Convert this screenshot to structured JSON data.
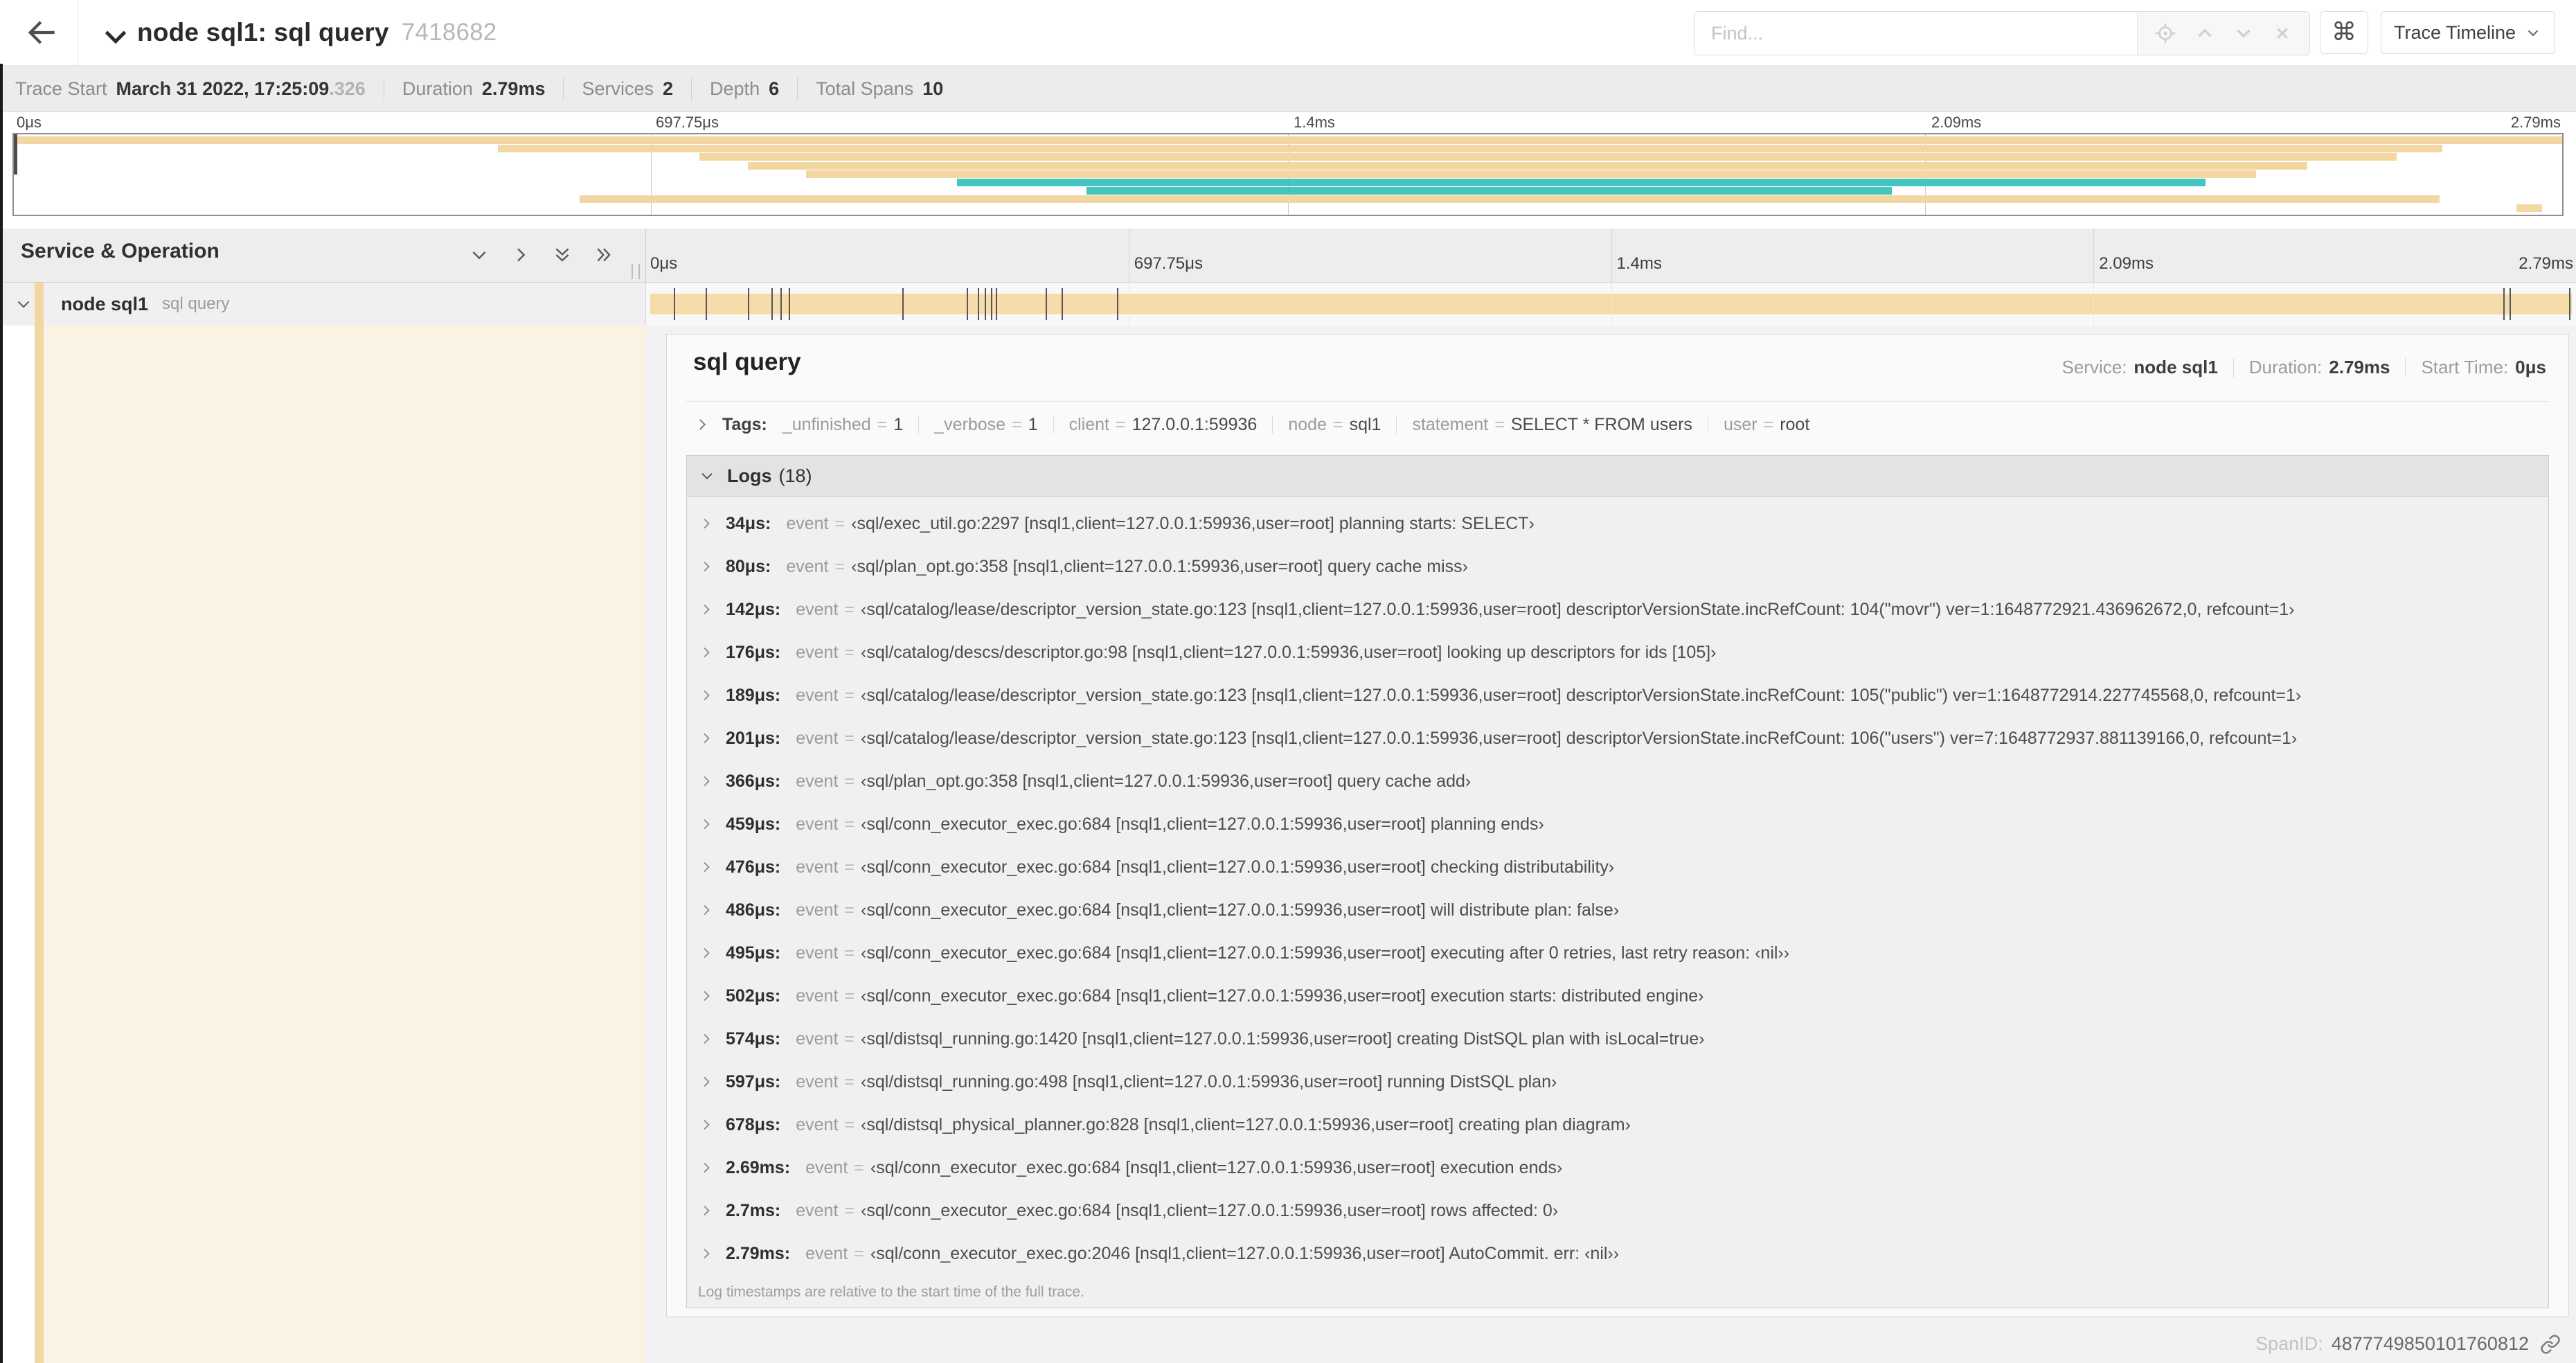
{
  "header": {
    "title": "node sql1: sql query",
    "trace_id": "7418682",
    "find_placeholder": "Find...",
    "shortcut_button": "⌘",
    "view_selector": "Trace Timeline"
  },
  "summary": {
    "items": [
      {
        "label": "Trace Start",
        "value": "March 31 2022, 17:25:09",
        "suffix": ".326"
      },
      {
        "label": "Duration",
        "value": "2.79ms"
      },
      {
        "label": "Services",
        "value": "2"
      },
      {
        "label": "Depth",
        "value": "6"
      },
      {
        "label": "Total Spans",
        "value": "10"
      }
    ]
  },
  "minimap": {
    "ticks": [
      "0μs",
      "697.75μs",
      "1.4ms",
      "2.09ms",
      "2.79ms"
    ],
    "duration_us": 2790,
    "spans": [
      {
        "start": 0.0,
        "end": 1.0,
        "color": "tan"
      },
      {
        "start": 0.19,
        "end": 0.953,
        "color": "tan"
      },
      {
        "start": 0.269,
        "end": 0.935,
        "color": "tan"
      },
      {
        "start": 0.288,
        "end": 0.9,
        "color": "tan"
      },
      {
        "start": 0.311,
        "end": 0.88,
        "color": "tan"
      },
      {
        "start": 0.37,
        "end": 0.86,
        "color": "teal"
      },
      {
        "start": 0.421,
        "end": 0.737,
        "color": "teal"
      },
      {
        "start": 0.222,
        "end": 0.952,
        "color": "tan"
      },
      {
        "start": 0.982,
        "end": 0.992,
        "color": "tan"
      }
    ]
  },
  "timeline": {
    "left_header": "Service & Operation",
    "ticks": [
      "0μs",
      "697.75μs",
      "1.4ms",
      "2.09ms",
      "2.79ms"
    ],
    "row": {
      "service": "node sql1",
      "operation": "sql query",
      "event_ticks_us": [
        34,
        80,
        142,
        176,
        189,
        201,
        366,
        459,
        476,
        486,
        495,
        502,
        574,
        597,
        678,
        2690,
        2700,
        2790
      ]
    }
  },
  "detail": {
    "title": "sql query",
    "stats": [
      {
        "label": "Service:",
        "value": "node sql1"
      },
      {
        "label": "Duration:",
        "value": "2.79ms"
      },
      {
        "label": "Start Time:",
        "value": "0μs"
      }
    ],
    "tags": {
      "label": "Tags:",
      "items": [
        {
          "key": "_unfinished",
          "value": "1"
        },
        {
          "key": "_verbose",
          "value": "1"
        },
        {
          "key": "client",
          "value": "127.0.0.1:59936"
        },
        {
          "key": "node",
          "value": "sql1"
        },
        {
          "key": "statement",
          "value": "SELECT * FROM users"
        },
        {
          "key": "user",
          "value": "root"
        }
      ]
    },
    "logs": {
      "title": "Logs",
      "count": "(18)",
      "event_key": "event",
      "rows": [
        {
          "time": "34μs:",
          "value": "‹sql/exec_util.go:2297 [nsql1,client=127.0.0.1:59936,user=root] planning starts: SELECT›"
        },
        {
          "time": "80μs:",
          "value": "‹sql/plan_opt.go:358 [nsql1,client=127.0.0.1:59936,user=root] query cache miss›"
        },
        {
          "time": "142μs:",
          "value": "‹sql/catalog/lease/descriptor_version_state.go:123 [nsql1,client=127.0.0.1:59936,user=root] descriptorVersionState.incRefCount: 104(\"movr\") ver=1:1648772921.436962672,0, refcount=1›"
        },
        {
          "time": "176μs:",
          "value": "‹sql/catalog/descs/descriptor.go:98 [nsql1,client=127.0.0.1:59936,user=root] looking up descriptors for ids [105]›"
        },
        {
          "time": "189μs:",
          "value": "‹sql/catalog/lease/descriptor_version_state.go:123 [nsql1,client=127.0.0.1:59936,user=root] descriptorVersionState.incRefCount: 105(\"public\") ver=1:1648772914.227745568,0, refcount=1›"
        },
        {
          "time": "201μs:",
          "value": "‹sql/catalog/lease/descriptor_version_state.go:123 [nsql1,client=127.0.0.1:59936,user=root] descriptorVersionState.incRefCount: 106(\"users\") ver=7:1648772937.881139166,0, refcount=1›"
        },
        {
          "time": "366μs:",
          "value": "‹sql/plan_opt.go:358 [nsql1,client=127.0.0.1:59936,user=root] query cache add›"
        },
        {
          "time": "459μs:",
          "value": "‹sql/conn_executor_exec.go:684 [nsql1,client=127.0.0.1:59936,user=root] planning ends›"
        },
        {
          "time": "476μs:",
          "value": "‹sql/conn_executor_exec.go:684 [nsql1,client=127.0.0.1:59936,user=root] checking distributability›"
        },
        {
          "time": "486μs:",
          "value": "‹sql/conn_executor_exec.go:684 [nsql1,client=127.0.0.1:59936,user=root] will distribute plan: false›"
        },
        {
          "time": "495μs:",
          "value": "‹sql/conn_executor_exec.go:684 [nsql1,client=127.0.0.1:59936,user=root] executing after 0 retries, last retry reason: ‹nil››"
        },
        {
          "time": "502μs:",
          "value": "‹sql/conn_executor_exec.go:684 [nsql1,client=127.0.0.1:59936,user=root] execution starts: distributed engine›"
        },
        {
          "time": "574μs:",
          "value": "‹sql/distsql_running.go:1420 [nsql1,client=127.0.0.1:59936,user=root] creating DistSQL plan with isLocal=true›"
        },
        {
          "time": "597μs:",
          "value": "‹sql/distsql_running.go:498 [nsql1,client=127.0.0.1:59936,user=root] running DistSQL plan›"
        },
        {
          "time": "678μs:",
          "value": "‹sql/distsql_physical_planner.go:828 [nsql1,client=127.0.0.1:59936,user=root] creating plan diagram›"
        },
        {
          "time": "2.69ms:",
          "value": "‹sql/conn_executor_exec.go:684 [nsql1,client=127.0.0.1:59936,user=root] execution ends›"
        },
        {
          "time": "2.7ms:",
          "value": "‹sql/conn_executor_exec.go:684 [nsql1,client=127.0.0.1:59936,user=root] rows affected: 0›"
        },
        {
          "time": "2.79ms:",
          "value": "‹sql/conn_executor_exec.go:2046 [nsql1,client=127.0.0.1:59936,user=root] AutoCommit. err: ‹nil››"
        }
      ],
      "footnote": "Log timestamps are relative to the start time of the full trace."
    },
    "span_id": {
      "label": "SpanID:",
      "value": "4877749850101760812"
    }
  },
  "colors": {
    "span_tan": "#F2D7A2",
    "span_bar": "#F5DCA9",
    "span_teal": "#45C5C0",
    "detail_cream": "#FAF3E4"
  }
}
